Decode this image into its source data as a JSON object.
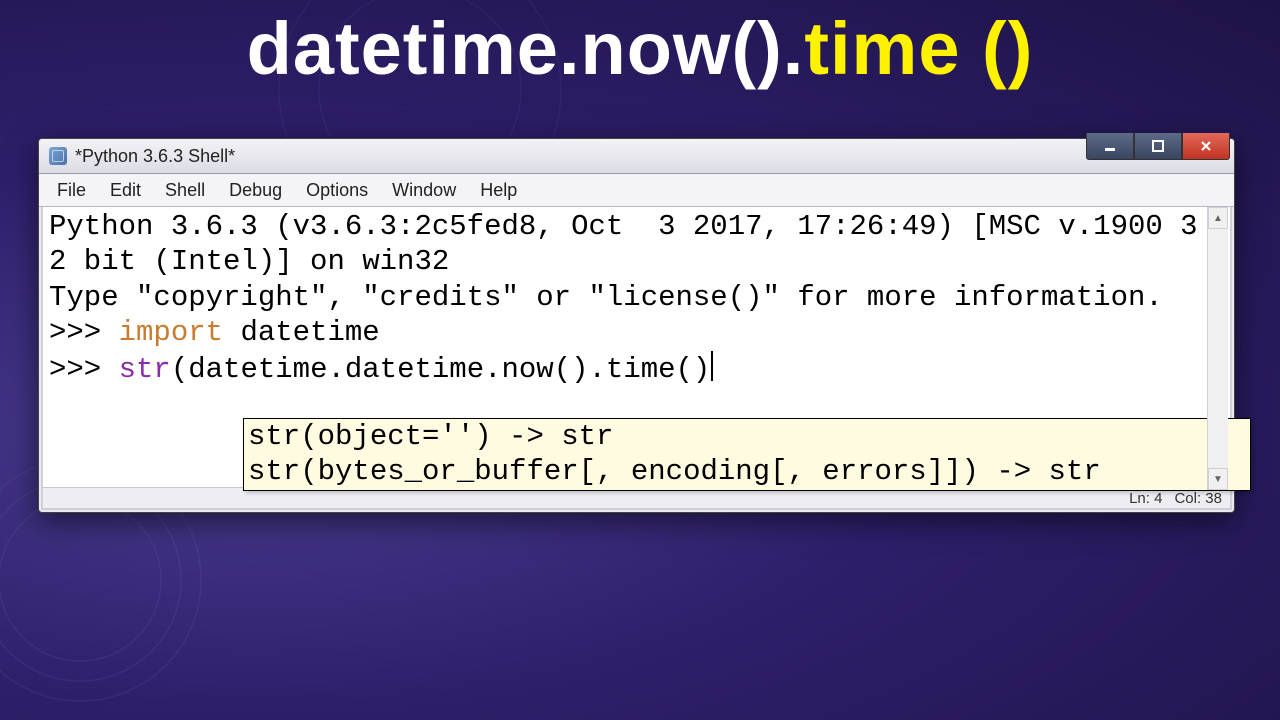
{
  "headline": {
    "part1": "datetime.now().",
    "part2": "time ()"
  },
  "window": {
    "title": "*Python 3.6.3 Shell*",
    "menus": [
      "File",
      "Edit",
      "Shell",
      "Debug",
      "Options",
      "Window",
      "Help"
    ],
    "banner_line1": "Python 3.6.3 (v3.6.3:2c5fed8, Oct  3 2017, 17:26:49) [MSC v.1900 32 bit (Intel)] on win32",
    "banner_line2": "Type \"copyright\", \"credits\" or \"license()\" for more information.",
    "prompt": ">>> ",
    "code1_kw": "import",
    "code1_rest": " datetime",
    "code2_builtin": "str",
    "code2_rest": "(datetime.datetime.now().time()",
    "tooltip_line1": "str(object='') -> str",
    "tooltip_line2": "str(bytes_or_buffer[, encoding[, errors]]) -> str",
    "status_ln": "Ln: 4",
    "status_col": "Col: 38"
  }
}
